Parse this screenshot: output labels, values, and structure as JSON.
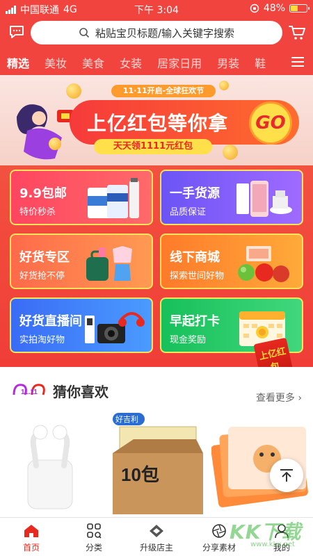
{
  "status_bar": {
    "carrier": "中国联通",
    "network": "4G",
    "time": "下午 3:04",
    "battery_text": "48%",
    "battery_level": 0.48
  },
  "header": {
    "search_placeholder": "粘贴宝贝标题/输入关键字搜索"
  },
  "tabs": [
    "精选",
    "美妆",
    "美食",
    "女装",
    "居家日用",
    "男装",
    "鞋"
  ],
  "active_tab": 0,
  "banner": {
    "top_badge": "11·11开启-全球狂欢节",
    "title": "上亿红包等你拿",
    "go_label": "GO",
    "subtitle": "天天领1111元红包"
  },
  "grid": [
    {
      "title": "9.9包邮",
      "subtitle": "特价秒杀"
    },
    {
      "title": "一手货源",
      "subtitle": "品质保证"
    },
    {
      "title": "好货专区",
      "subtitle": "好货抢不停"
    },
    {
      "title": "线下商城",
      "subtitle": "探索世间好物"
    },
    {
      "title": "好货直播间",
      "subtitle": "实拍淘好物"
    },
    {
      "title": "早起打卡",
      "subtitle": "现金奖励"
    }
  ],
  "guess": {
    "logo_text": "11.11",
    "title": "猜你喜欢",
    "more_label": "查看更多"
  },
  "hongbao_text": "上亿红包",
  "products": [
    {
      "icon": "earbuds-product-image"
    },
    {
      "label": "10包",
      "brand": "好吉利",
      "icon": "tissue-box-product-image"
    },
    {
      "icon": "heat-patch-product-image"
    }
  ],
  "bottom_nav": [
    {
      "label": "首页",
      "icon": "home-icon"
    },
    {
      "label": "分类",
      "icon": "grid-icon"
    },
    {
      "label": "升级店主",
      "icon": "diamond-icon"
    },
    {
      "label": "分享素材",
      "icon": "aperture-icon"
    },
    {
      "label": "我的",
      "icon": "user-icon"
    }
  ],
  "active_nav": 0,
  "watermark": {
    "text": "KK下载",
    "url": "www.kkx.net"
  },
  "colors": {
    "brand_red": "#f2443f",
    "active_red": "#e8291f",
    "gold": "#ffe04a"
  }
}
